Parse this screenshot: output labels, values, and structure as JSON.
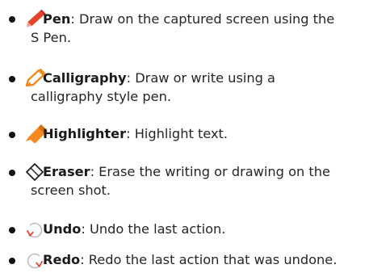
{
  "colors": {
    "pen": "#e5432d",
    "calligraphy": "#f4891f",
    "highlighter": "#f4891f",
    "eraser_outline": "#222222",
    "undo_redo_outline": "#bdbdbd",
    "undo_redo_arrow": "#e5432d"
  },
  "items": [
    {
      "icon": "pen-icon",
      "term": "Pen",
      "line1": ": Draw on the captured screen using the",
      "line2": "S Pen."
    },
    {
      "icon": "calligraphy-pen-icon",
      "term": "Calligraphy",
      "line1": ": Draw or write using a",
      "line2": "calligraphy style pen."
    },
    {
      "icon": "highlighter-icon",
      "term": "Highlighter",
      "line1": ": Highlight text."
    },
    {
      "icon": "eraser-icon",
      "term": "Eraser",
      "line1": ": Erase the writing or drawing on the",
      "line2": "screen shot."
    },
    {
      "icon": "undo-icon",
      "term": "Undo",
      "line1": ": Undo the last action."
    },
    {
      "icon": "redo-icon",
      "term": "Redo",
      "line1": ": Redo the last action that was undone."
    }
  ]
}
